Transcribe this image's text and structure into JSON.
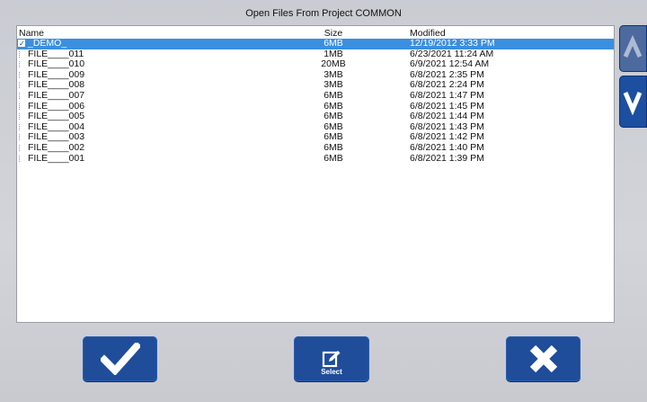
{
  "window": {
    "title": "Open Files From Project  COMMON"
  },
  "table": {
    "headers": {
      "name": "Name",
      "size": "Size",
      "modified": "Modified"
    },
    "rows": [
      {
        "name": "_DEMO_",
        "size": "6MB",
        "modified": "12/19/2012  3:33 PM",
        "selected": true,
        "checked": true
      },
      {
        "name": "FILE____011",
        "size": "1MB",
        "modified": "6/23/2021  11:24 AM",
        "selected": false,
        "checked": false
      },
      {
        "name": "FILE____010",
        "size": "20MB",
        "modified": "6/9/2021  12:54 AM",
        "selected": false,
        "checked": false
      },
      {
        "name": "FILE____009",
        "size": "3MB",
        "modified": "6/8/2021  2:35 PM",
        "selected": false,
        "checked": false
      },
      {
        "name": "FILE____008",
        "size": "3MB",
        "modified": "6/8/2021  2:24 PM",
        "selected": false,
        "checked": false
      },
      {
        "name": "FILE____007",
        "size": "6MB",
        "modified": "6/8/2021  1:47 PM",
        "selected": false,
        "checked": false
      },
      {
        "name": "FILE____006",
        "size": "6MB",
        "modified": "6/8/2021  1:45 PM",
        "selected": false,
        "checked": false
      },
      {
        "name": "FILE____005",
        "size": "6MB",
        "modified": "6/8/2021  1:44 PM",
        "selected": false,
        "checked": false
      },
      {
        "name": "FILE____004",
        "size": "6MB",
        "modified": "6/8/2021  1:43 PM",
        "selected": false,
        "checked": false
      },
      {
        "name": "FILE____003",
        "size": "6MB",
        "modified": "6/8/2021  1:42 PM",
        "selected": false,
        "checked": false
      },
      {
        "name": "FILE____002",
        "size": "6MB",
        "modified": "6/8/2021  1:40 PM",
        "selected": false,
        "checked": false
      },
      {
        "name": "FILE____001",
        "size": "6MB",
        "modified": "6/8/2021  1:39 PM",
        "selected": false,
        "checked": false
      }
    ]
  },
  "scroll": {
    "up_icon": "chevron-up-icon",
    "down_icon": "chevron-down-icon"
  },
  "actions": {
    "ok_icon": "checkmark-icon",
    "select_icon": "edit-select-icon",
    "select_label": "Select",
    "cancel_icon": "close-x-icon"
  },
  "colors": {
    "button_blue": "#1f4d9a",
    "selected_row": "#3a8fe0",
    "background": "#d2d4d9"
  }
}
